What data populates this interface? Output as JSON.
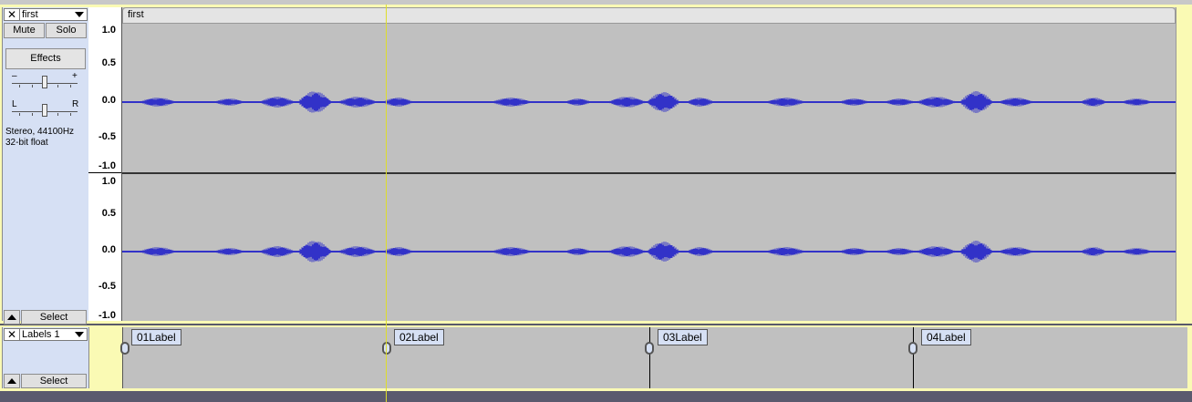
{
  "audio_track": {
    "name": "first",
    "mute_label": "Mute",
    "solo_label": "Solo",
    "effects_label": "Effects",
    "gain_minus": "–",
    "gain_plus": "+",
    "pan_left": "L",
    "pan_right": "R",
    "format_line1": "Stereo, 44100Hz",
    "format_line2": "32-bit float",
    "select_label": "Select",
    "clip_name": "first",
    "ruler": {
      "top": [
        "1.0",
        "0.5",
        "0.0",
        "-0.5",
        "-1.0"
      ],
      "bottom": [
        "1.0",
        "0.5",
        "0.0",
        "-0.5",
        "-1.0"
      ]
    },
    "waveform_color": "#3232c8"
  },
  "label_track": {
    "name": "Labels 1",
    "select_label": "Select",
    "labels": [
      {
        "text": "01Label"
      },
      {
        "text": "02Label"
      },
      {
        "text": "03Label"
      },
      {
        "text": "04Label"
      }
    ]
  },
  "colors": {
    "track_border": "#fafab4",
    "control_panel": "#d6e0f4",
    "wave_background": "#c0c0c0",
    "playhead": "#dede2a"
  }
}
